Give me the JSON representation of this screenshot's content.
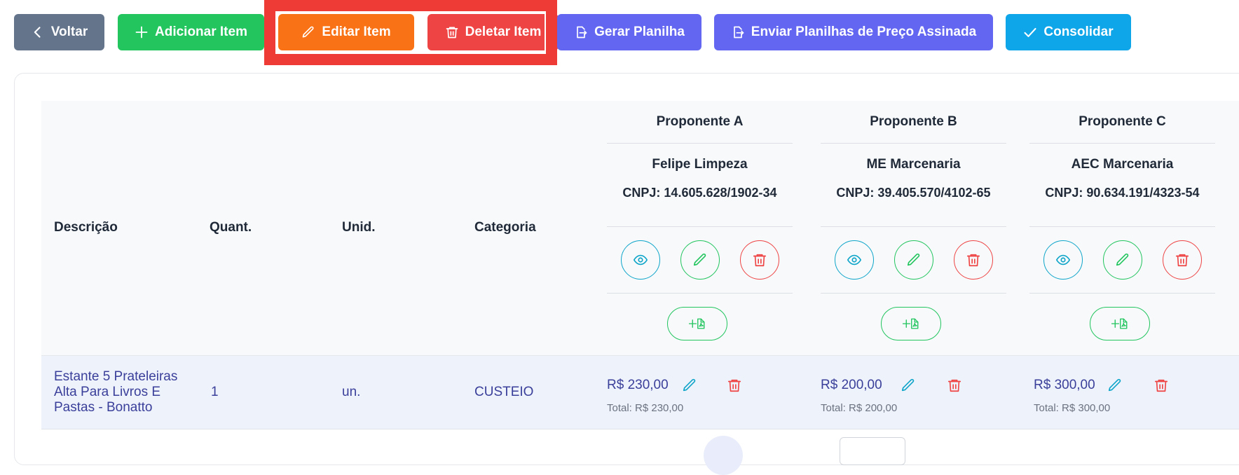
{
  "toolbar": {
    "back_label": "Voltar",
    "add_label": "Adicionar Item",
    "edit_label": "Editar Item",
    "delete_label": "Deletar Item",
    "generate_label": "Gerar Planilha",
    "send_label": "Enviar Planilhas de Preço Assinada",
    "consolidate_label": "Consolidar"
  },
  "colors": {
    "back": "#64748b",
    "add": "#22c55e",
    "edit": "#f97316",
    "delete": "#ef4444",
    "primary": "#6366f1",
    "consolidate": "#0ea5e9",
    "highlight": "#ef3b36"
  },
  "table": {
    "headers": {
      "description": "Descrição",
      "quantity": "Quant.",
      "unit": "Unid.",
      "category": "Categoria"
    },
    "proponents": [
      {
        "label": "Proponente A",
        "company": "Felipe Limpeza",
        "cnpj": "CNPJ: 14.605.628/1902-34"
      },
      {
        "label": "Proponente B",
        "company": "ME Marcenaria",
        "cnpj": "CNPJ: 39.405.570/4102-65"
      },
      {
        "label": "Proponente C",
        "company": "AEC Marcenaria",
        "cnpj": "CNPJ: 90.634.191/4323-54"
      }
    ],
    "rows": [
      {
        "description_lines": [
          "Estante 5 Prateleiras",
          "Alta Para Livros E",
          "Pastas - Bonatto"
        ],
        "quantity": "1",
        "unit": "un.",
        "category": "CUSTEIO",
        "prices": [
          {
            "price": "R$ 230,00",
            "total": "Total: R$ 230,00"
          },
          {
            "price": "R$ 200,00",
            "total": "Total: R$ 200,00"
          },
          {
            "price": "R$ 300,00",
            "total": "Total: R$ 300,00"
          }
        ]
      }
    ]
  },
  "icons": [
    "chevron-left-icon",
    "plus-icon",
    "pencil-icon",
    "trash-icon",
    "export-file-icon",
    "check-icon",
    "eye-icon",
    "add-pdf-icon"
  ]
}
